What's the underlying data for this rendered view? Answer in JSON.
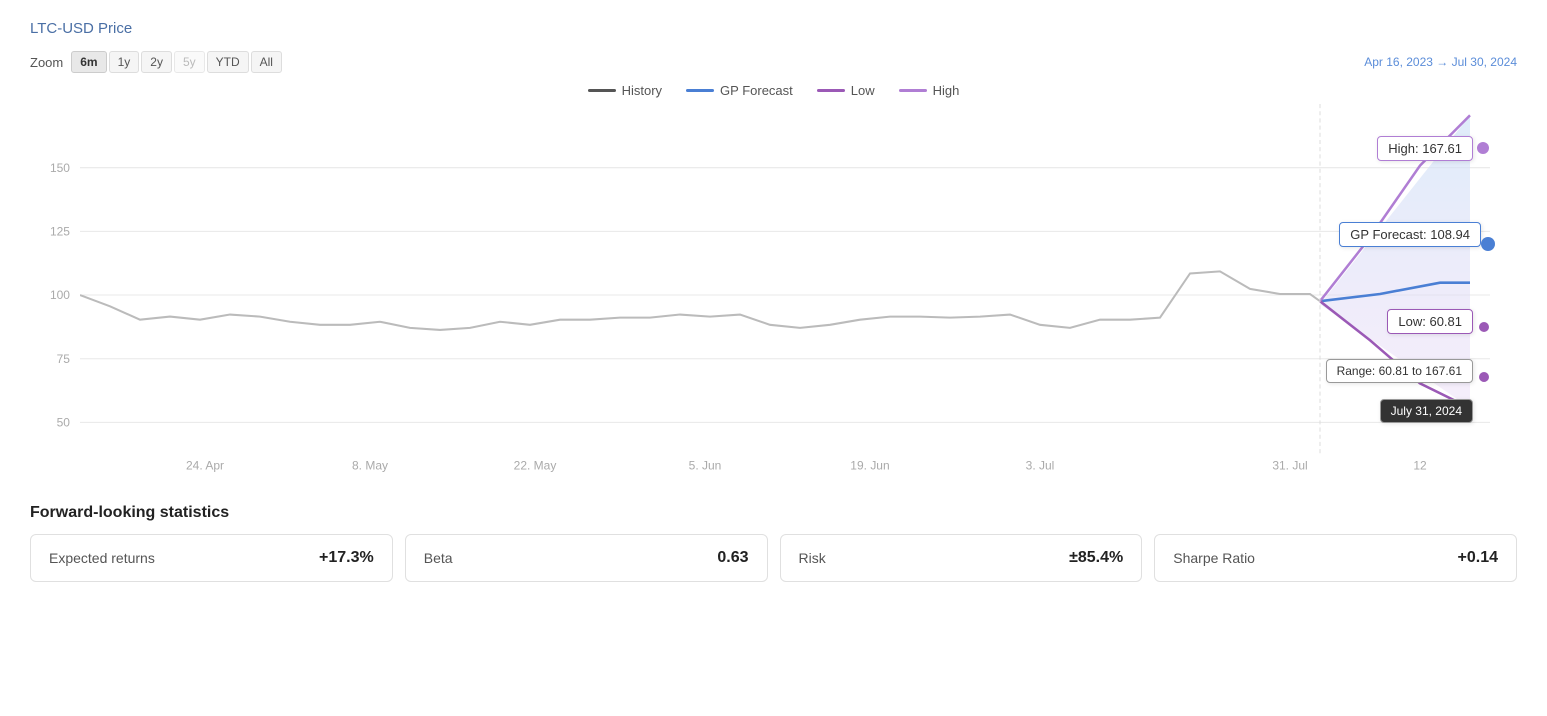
{
  "title": "LTC-USD Price",
  "zoom": {
    "label": "Zoom",
    "buttons": [
      {
        "id": "6m",
        "label": "6m",
        "active": true
      },
      {
        "id": "1y",
        "label": "1y",
        "active": false
      },
      {
        "id": "2y",
        "label": "2y",
        "active": false
      },
      {
        "id": "5y",
        "label": "5y",
        "active": false,
        "dim": true
      },
      {
        "id": "ytd",
        "label": "YTD",
        "active": false
      },
      {
        "id": "all",
        "label": "All",
        "active": false
      }
    ],
    "dateRange": "Apr 16, 2023 → Jul 30, 2024"
  },
  "legend": {
    "items": [
      {
        "id": "history",
        "label": "History",
        "lineType": "history"
      },
      {
        "id": "gp-forecast",
        "label": "GP Forecast",
        "lineType": "gp"
      },
      {
        "id": "low",
        "label": "Low",
        "lineType": "low"
      },
      {
        "id": "high",
        "label": "High",
        "lineType": "high"
      }
    ]
  },
  "tooltips": {
    "high": "High: 167.61",
    "gp": "GP Forecast: 108.94",
    "low": "Low: 60.81",
    "range": "Range: 60.81 to 167.61",
    "date": "July 31, 2024"
  },
  "yAxis": {
    "labels": [
      "50",
      "75",
      "100",
      "125",
      "150"
    ]
  },
  "xAxis": {
    "labels": [
      "24. Apr",
      "8. May",
      "22. May",
      "5. Jun",
      "19. Jun",
      "3. Jul",
      "31. Jul",
      "12"
    ]
  },
  "stats": {
    "title": "Forward-looking statistics",
    "cards": [
      {
        "id": "expected-returns",
        "label": "Expected returns",
        "value": "+17.3%"
      },
      {
        "id": "beta",
        "label": "Beta",
        "value": "0.63"
      },
      {
        "id": "risk",
        "label": "Risk",
        "value": "±85.4%"
      },
      {
        "id": "sharpe-ratio",
        "label": "Sharpe Ratio",
        "value": "+0.14"
      }
    ]
  }
}
